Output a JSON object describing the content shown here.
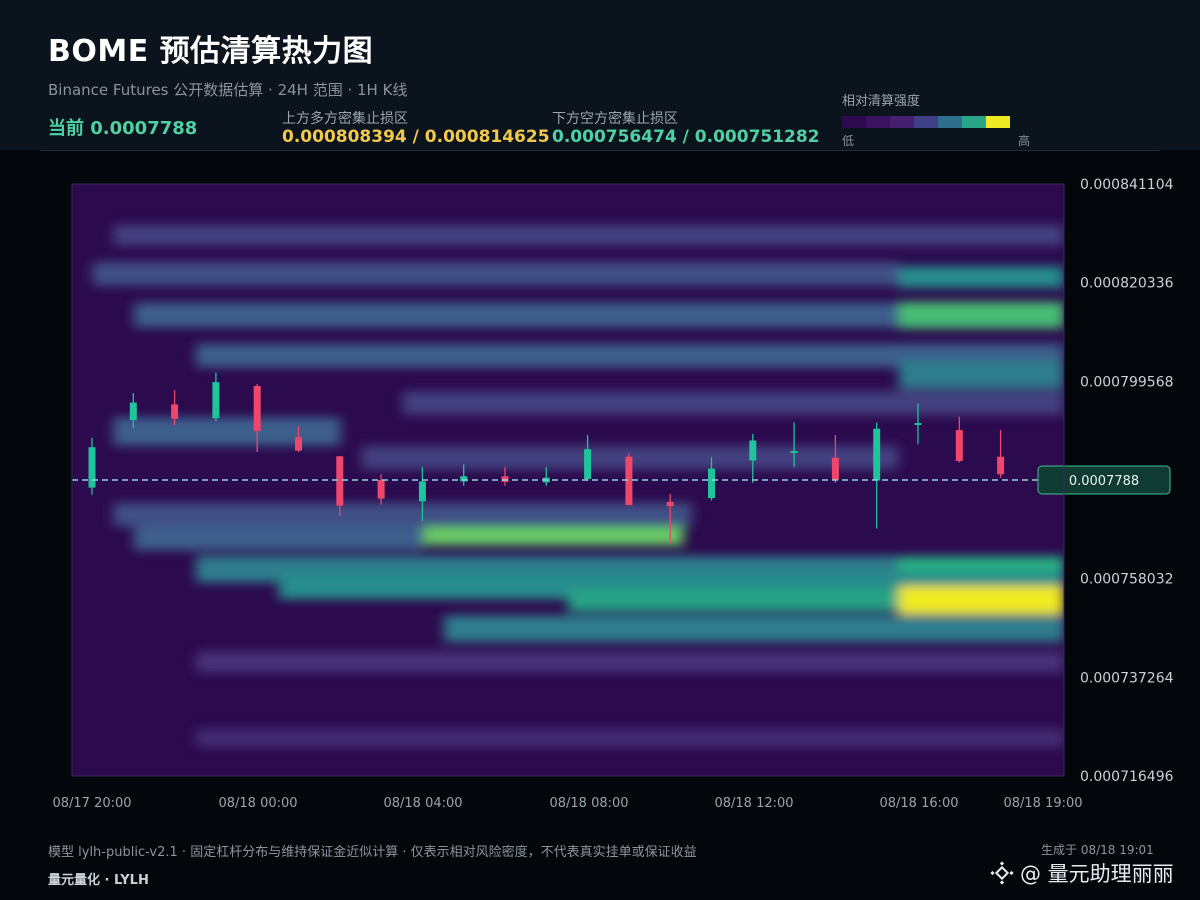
{
  "header": {
    "title": "BOME 预估清算热力图",
    "subtitle": "Binance Futures 公开数据估算 · 24H 范围 · 1H K线",
    "current": "当前 0.0007788",
    "upper_zone_label": "上方多方密集止损区",
    "upper_zone_value": "0.000808394 / 0.000814625",
    "lower_zone_label": "下方空方密集止损区",
    "lower_zone_value": "0.000756474 / 0.000751282",
    "legend_title": "相对清算强度",
    "legend_low": "低",
    "legend_high": "高",
    "legend_colors": [
      "#2d0a4e",
      "#3a1260",
      "#45206e",
      "#3f3f86",
      "#2f6f8e",
      "#2aa487",
      "#f0ea24"
    ]
  },
  "colors": {
    "up": "#1fc49a",
    "down": "#f0466b",
    "current_line": "#8fd3df",
    "accent_green": "#4fd1a5",
    "accent_yellow": "#f2c94c"
  },
  "chart_data": {
    "type": "heatmap",
    "title": "BOME 预估清算热力图",
    "y_ticks": [
      "0.000841104",
      "0.000820336",
      "0.000799568",
      "0.000778800",
      "0.000758032",
      "0.000737264",
      "0.000716496"
    ],
    "y_tick_labels": [
      "0.000841104",
      "0.000820336",
      "0.000799568",
      "0.000758032",
      "0.000737264",
      "0.000716496"
    ],
    "ylim": [
      0.000716496,
      0.000841104
    ],
    "x_tick_labels": [
      "08/17 20:00",
      "08/18 00:00",
      "08/18 04:00",
      "08/18 08:00",
      "08/18 12:00",
      "08/18 16:00",
      "08/18 19:00"
    ],
    "x_tick_hours": [
      0,
      4,
      8,
      12,
      16,
      20,
      23
    ],
    "current_price": 0.0007788,
    "current_label": "0.0007788",
    "candles": [
      {
        "o": 0.0007772,
        "c": 0.0007857,
        "h": 0.0007877,
        "l": 0.0007757
      },
      {
        "o": 0.0007914,
        "c": 0.0007951,
        "h": 0.0007971,
        "l": 0.0007897
      },
      {
        "o": 0.0007947,
        "c": 0.0007917,
        "h": 0.0007977,
        "l": 0.0007903
      },
      {
        "o": 0.0007918,
        "c": 0.0007994,
        "h": 0.0008014,
        "l": 0.0007912
      },
      {
        "o": 0.0007986,
        "c": 0.0007891,
        "h": 0.000799,
        "l": 0.0007847
      },
      {
        "o": 0.0007878,
        "c": 0.000785,
        "h": 0.0007901,
        "l": 0.0007847
      },
      {
        "o": 0.0007838,
        "c": 0.0007734,
        "h": 0.0007838,
        "l": 0.0007712
      },
      {
        "o": 0.0007788,
        "c": 0.0007749,
        "h": 0.00078,
        "l": 0.0007736
      },
      {
        "o": 0.0007743,
        "c": 0.0007785,
        "h": 0.0007815,
        "l": 0.0007702
      },
      {
        "o": 0.0007785,
        "c": 0.0007796,
        "h": 0.0007821,
        "l": 0.0007776
      },
      {
        "o": 0.0007796,
        "c": 0.0007784,
        "h": 0.0007815,
        "l": 0.0007776
      },
      {
        "o": 0.0007783,
        "c": 0.0007793,
        "h": 0.0007815,
        "l": 0.0007776
      },
      {
        "o": 0.000779,
        "c": 0.0007853,
        "h": 0.0007883,
        "l": 0.0007786
      },
      {
        "o": 0.0007837,
        "c": 0.0007735,
        "h": 0.0007844,
        "l": 0.0007735
      },
      {
        "o": 0.0007742,
        "c": 0.0007733,
        "h": 0.0007759,
        "l": 0.0007655
      },
      {
        "o": 0.000775,
        "c": 0.0007812,
        "h": 0.0007836,
        "l": 0.0007745
      },
      {
        "o": 0.0007829,
        "c": 0.0007871,
        "h": 0.0007885,
        "l": 0.0007782
      },
      {
        "o": 0.0007849,
        "c": 0.0007849,
        "h": 0.0007909,
        "l": 0.0007815
      },
      {
        "o": 0.0007835,
        "c": 0.0007788,
        "h": 0.0007883,
        "l": 0.0007782
      },
      {
        "o": 0.0007787,
        "c": 0.0007896,
        "h": 0.0007909,
        "l": 0.0007686
      },
      {
        "o": 0.0007908,
        "c": 0.0007908,
        "h": 0.0007949,
        "l": 0.0007863
      },
      {
        "o": 0.0007893,
        "c": 0.0007828,
        "h": 0.0007921,
        "l": 0.0007825
      },
      {
        "o": 0.0007837,
        "c": 0.00078,
        "h": 0.0007893,
        "l": 0.0007793
      }
    ],
    "bands": [
      {
        "y": 0.0008303,
        "w": 2.2e-06,
        "x0": 1,
        "x1": 24,
        "v": 0.35
      },
      {
        "y": 0.0008222,
        "w": 2.5e-06,
        "x0": 0.5,
        "x1": 20,
        "v": 0.4
      },
      {
        "y": 0.0008215,
        "w": 2.3e-06,
        "x0": 20,
        "x1": 24,
        "v": 0.6
      },
      {
        "y": 0.0008135,
        "w": 2.6e-06,
        "x0": 1.5,
        "x1": 20,
        "v": 0.45
      },
      {
        "y": 0.0008135,
        "w": 2.8e-06,
        "x0": 20,
        "x1": 24,
        "v": 0.8
      },
      {
        "y": 0.000805,
        "w": 2.5e-06,
        "x0": 3,
        "x1": 24,
        "v": 0.45
      },
      {
        "y": 0.000801,
        "w": 3e-06,
        "x0": 20,
        "x1": 24,
        "v": 0.55
      },
      {
        "y": 0.000795,
        "w": 2.5e-06,
        "x0": 8,
        "x1": 24,
        "v": 0.35
      },
      {
        "y": 0.000789,
        "w": 3e-06,
        "x0": 1,
        "x1": 6.5,
        "v": 0.45
      },
      {
        "y": 0.0007835,
        "w": 2.5e-06,
        "x0": 7,
        "x1": 20,
        "v": 0.35
      },
      {
        "y": 0.0007715,
        "w": 2.5e-06,
        "x0": 1,
        "x1": 15,
        "v": 0.4
      },
      {
        "y": 0.000767,
        "w": 2e-06,
        "x0": 8.5,
        "x1": 14.8,
        "v": 0.85
      },
      {
        "y": 0.0007665,
        "w": 2.5e-06,
        "x0": 1.5,
        "x1": 8.5,
        "v": 0.45
      },
      {
        "y": 0.00076,
        "w": 2.8e-06,
        "x0": 3,
        "x1": 24,
        "v": 0.55
      },
      {
        "y": 0.0007595,
        "w": 3e-06,
        "x0": 20,
        "x1": 24,
        "v": 0.75
      },
      {
        "y": 0.0007565,
        "w": 2.8e-06,
        "x0": 5,
        "x1": 24,
        "v": 0.6
      },
      {
        "y": 0.0007535,
        "w": 2.4e-06,
        "x0": 12,
        "x1": 24,
        "v": 0.7
      },
      {
        "y": 0.0007535,
        "w": 3e-06,
        "x0": 20,
        "x1": 24,
        "v": 1.0
      },
      {
        "y": 0.0007475,
        "w": 2.8e-06,
        "x0": 9,
        "x1": 24,
        "v": 0.55
      },
      {
        "y": 0.0007405,
        "w": 2.2e-06,
        "x0": 3,
        "x1": 24,
        "v": 0.3
      },
      {
        "y": 0.0007245,
        "w": 2e-06,
        "x0": 3,
        "x1": 24,
        "v": 0.25
      }
    ]
  },
  "footer": {
    "note": "模型 lylh-public-v2.1 · 固定杠杆分布与维持保证金近似计算 · 仅表示相对风险密度，不代表真实挂单或保证收益",
    "brand": "量元量化 · LYLH",
    "generated": "生成于 08/18 19:01",
    "watermark": "@ 量元助理丽丽"
  }
}
